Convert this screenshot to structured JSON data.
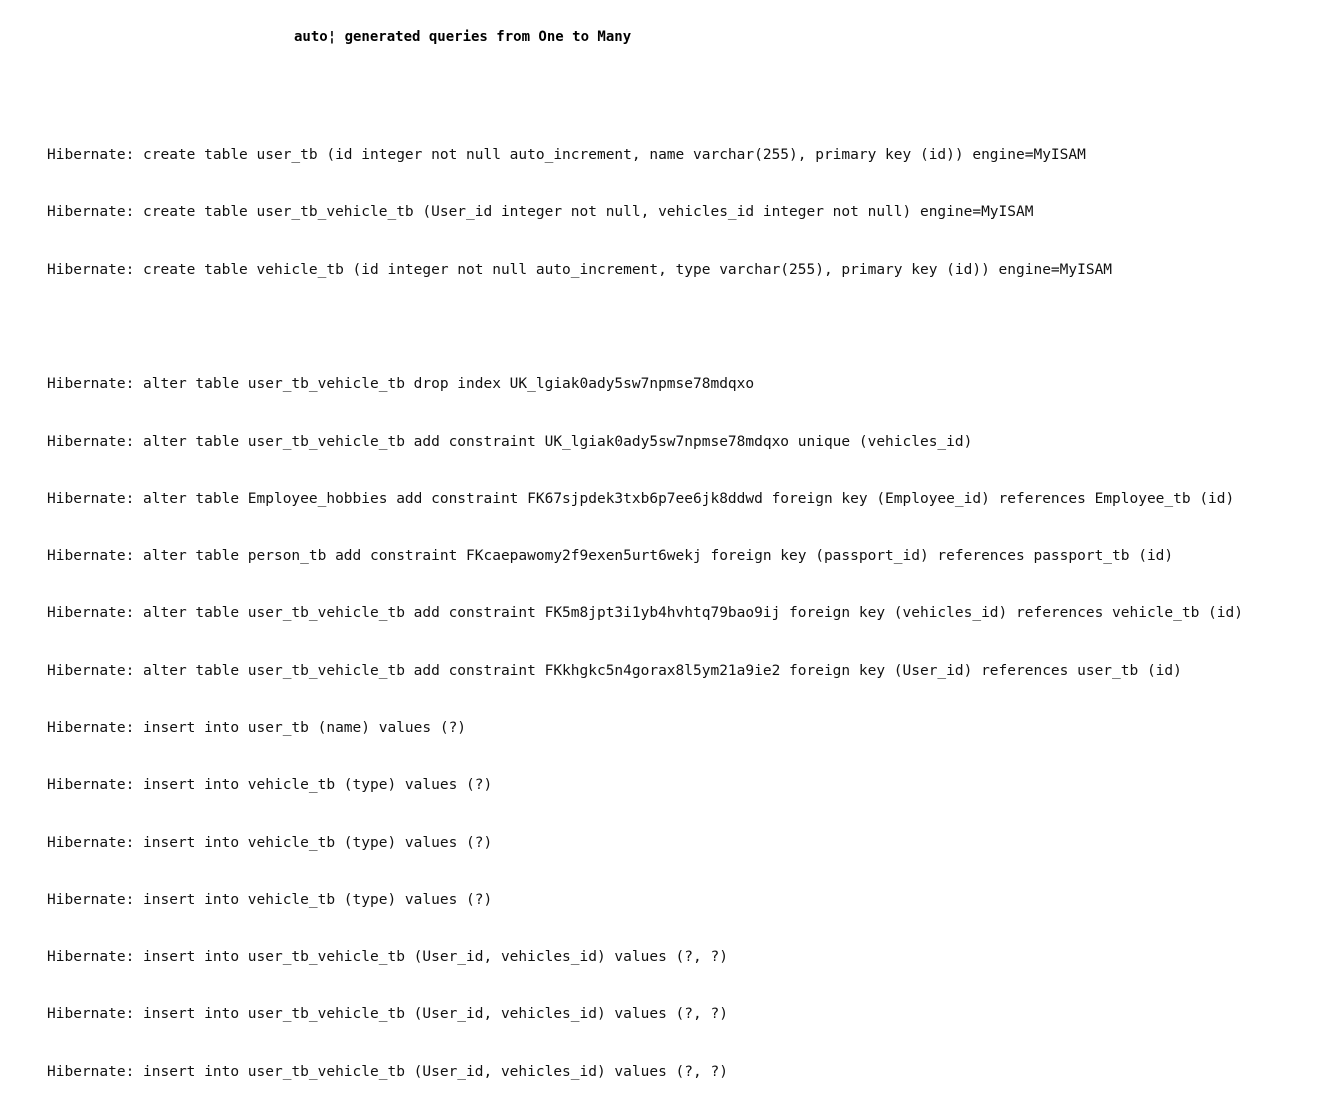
{
  "heading": "auto¦ generated queries from One to Many",
  "group1": [
    "Hibernate: create table user_tb (id integer not null auto_increment, name varchar(255), primary key (id)) engine=MyISAM",
    "Hibernate: create table user_tb_vehicle_tb (User_id integer not null, vehicles_id integer not null) engine=MyISAM",
    "Hibernate: create table vehicle_tb (id integer not null auto_increment, type varchar(255), primary key (id)) engine=MyISAM"
  ],
  "group2": [
    "Hibernate: alter table user_tb_vehicle_tb drop index UK_lgiak0ady5sw7npmse78mdqxo",
    "Hibernate: alter table user_tb_vehicle_tb add constraint UK_lgiak0ady5sw7npmse78mdqxo unique (vehicles_id)",
    "Hibernate: alter table Employee_hobbies add constraint FK67sjpdek3txb6p7ee6jk8ddwd foreign key (Employee_id) references Employee_tb (id)",
    "Hibernate: alter table person_tb add constraint FKcaepawomy2f9exen5urt6wekj foreign key (passport_id) references passport_tb (id)",
    "Hibernate: alter table user_tb_vehicle_tb add constraint FK5m8jpt3i1yb4hvhtq79bao9ij foreign key (vehicles_id) references vehicle_tb (id)",
    "Hibernate: alter table user_tb_vehicle_tb add constraint FKkhgkc5n4gorax8l5ym21a9ie2 foreign key (User_id) references user_tb (id)",
    "Hibernate: insert into user_tb (name) values (?)",
    "Hibernate: insert into vehicle_tb (type) values (?)",
    "Hibernate: insert into vehicle_tb (type) values (?)",
    "Hibernate: insert into vehicle_tb (type) values (?)",
    "Hibernate: insert into user_tb_vehicle_tb (User_id, vehicles_id) values (?, ?)",
    "Hibernate: insert into user_tb_vehicle_tb (User_id, vehicles_id) values (?, ?)",
    "Hibernate: insert into user_tb_vehicle_tb (User_id, vehicles_id) values (?, ?)"
  ]
}
